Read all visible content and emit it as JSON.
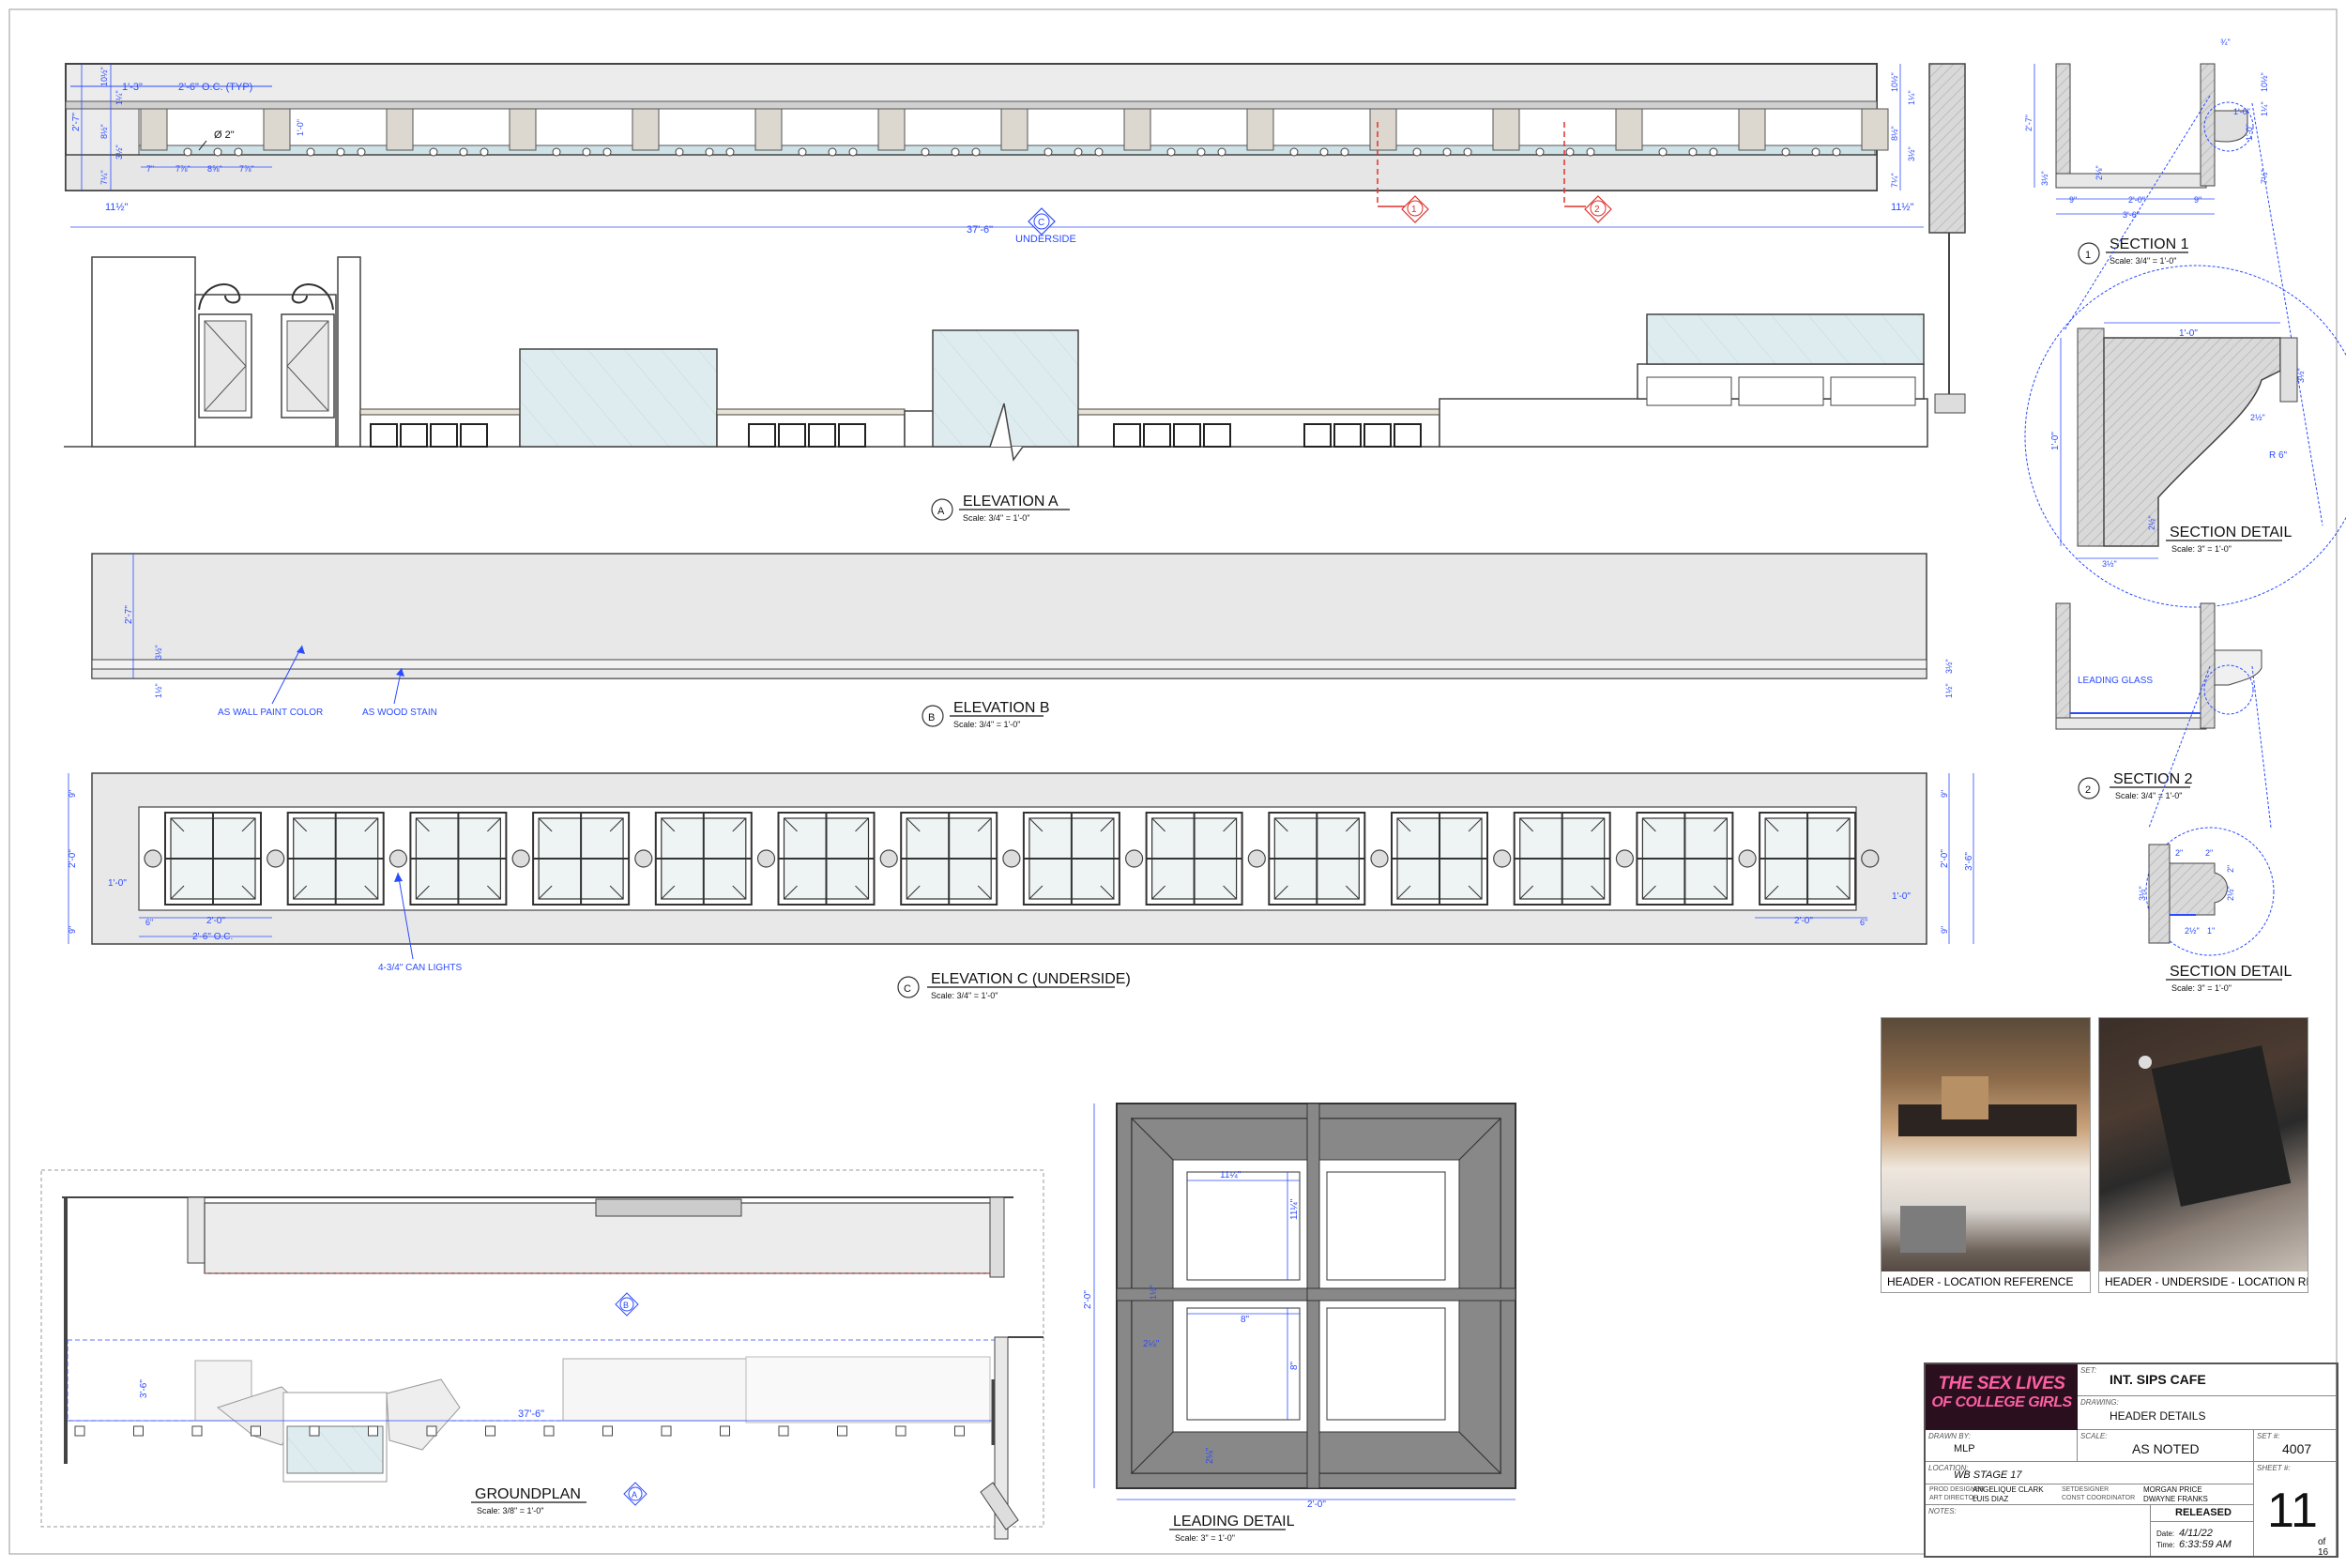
{
  "elevation_a": {
    "title": "ELEVATION A",
    "scale": "Scale: 3/4\" = 1'-0\"",
    "marker": "A",
    "dims": {
      "spacing": "2'-6\" O.C. (TYP)",
      "left_offset": "1'-3\"",
      "diameter": "Ø 2\"",
      "overall": "37'-6\"",
      "end_left": "11½\"",
      "end_right": "11½\"",
      "d1": "7\"",
      "d2": "7⅞\"",
      "d3": "8⅝\"",
      "d4": "7⅞\"",
      "h_total": "2'-7\"",
      "h_mid": "1'-0\"",
      "h_a": "10½\"",
      "h_b": "1¼\"",
      "h_c": "8½\"",
      "h_d": "3½\"",
      "h_e": "7¼\""
    },
    "underside_marker": "C",
    "underside_label": "UNDERSIDE",
    "section_tags": [
      "1",
      "2"
    ]
  },
  "elevation_b": {
    "title": "ELEVATION B",
    "scale": "Scale: 3/4\" = 1'-0\"",
    "marker": "B",
    "notes": [
      "AS WALL PAINT COLOR",
      "AS WOOD STAIN"
    ],
    "dims": {
      "h_total": "2'-7\"",
      "h_a": "3½\"",
      "h_b": "1½\"",
      "r_a": "3½\"",
      "r_b": "1½\""
    }
  },
  "elevation_c": {
    "title": "ELEVATION C (UNDERSIDE)",
    "scale": "Scale: 3/4\" = 1'-0\"",
    "marker": "C",
    "note": "4-3/4\" CAN LIGHTS",
    "dims": {
      "top": "9\"",
      "bottom": "9\"",
      "height": "2'-0\"",
      "height_r": "3'-6\"",
      "left": "1'-0\"",
      "right": "1'-0\"",
      "six": "6\"",
      "two": "2'-0\"",
      "oc": "2'-6\" O.C.",
      "two_r": "2'-0\"",
      "six_r": "6\"",
      "top_r": "9\"",
      "bottom_r": "9\"",
      "height_r2": "2'-0\""
    },
    "panel_count": 14
  },
  "groundplan": {
    "title": "GROUNDPLAN",
    "scale": "Scale: 3/8\" = 1'-0\"",
    "marker_b": "B",
    "marker_a": "A",
    "dims": {
      "overall": "37'-6\"",
      "depth": "3'-6\""
    }
  },
  "leading_detail": {
    "title": "LEADING DETAIL",
    "scale": "Scale: 3\" = 1'-0\"",
    "dims": {
      "a": "11¼\"",
      "b": "11¼\"",
      "c": "1½\"",
      "d": "8\"",
      "e": "8\"",
      "f": "2¼\"",
      "g": "2¼\"",
      "h": "2'-0\"",
      "w": "2'-0\""
    }
  },
  "section1": {
    "title": "SECTION 1",
    "scale": "Scale: 3/4\" = 1'-0\"",
    "number": "1",
    "dims": {
      "top": "¾\"",
      "h": "2'-7\"",
      "a": "10½\"",
      "b": "1¼\"",
      "c": "1'-0\"",
      "d": "3½\"",
      "e": "1½\"",
      "f": "9\"",
      "g": "2'-0\"",
      "h2": "9\"",
      "w": "3'-6\"",
      "i": "2⅛\"",
      "j": "1'-0\"",
      "k": "3½\"",
      "l": "7½\""
    }
  },
  "section_detail_1": {
    "title": "SECTION DETAIL",
    "scale": "Scale: 3\" = 1'-0\"",
    "dims": {
      "top": "1'-0\"",
      "a": "3½\"",
      "b": "2½\"",
      "r": "R 6\"",
      "h": "1'-0\"",
      "c": "2½\"",
      "bottom": "3½\""
    }
  },
  "section2": {
    "title": "SECTION 2",
    "scale": "Scale: 3/4\" = 1'-0\"",
    "number": "2",
    "note": "LEADING GLASS"
  },
  "section_detail_2": {
    "title": "SECTION DETAIL",
    "scale": "Scale: 3\" = 1'-0\"",
    "dims": {
      "a": "2\"",
      "b": "2\"",
      "c": "3½\"",
      "d": "2\"",
      "e": "2½\"",
      "f": "2½\"",
      "g": "1\""
    }
  },
  "photos": [
    {
      "caption": "HEADER - LOCATION REFERENCE"
    },
    {
      "caption": "HEADER - UNDERSIDE - LOCATION REFERENCE"
    }
  ],
  "title_block": {
    "logo_line1": "THE SEX LIVES",
    "logo_line2": "OF COLLEGE GIRLS",
    "set_label": "SET:",
    "set": "INT. SIPS CAFE",
    "drawing_label": "DRAWING:",
    "drawing": "HEADER DETAILS",
    "drawn_by_label": "DRAWN BY:",
    "drawn_by": "MLP",
    "scale_label": "SCALE:",
    "scale": "AS NOTED",
    "set_no_label": "SET #:",
    "set_no": "4007",
    "location_label": "LOCATION:",
    "location": "WB STAGE 17",
    "sheet_label": "SHEET #:",
    "sheet": "11",
    "sheet_of": "of 16",
    "prod_designer_label": "PROD DESIGNER",
    "prod_designer": "ANGELIQUE CLARK",
    "art_director_label": "ART DIRECTOR",
    "art_director": "LUIS DIAZ",
    "set_designer_label": "SETDESIGNER",
    "set_designer": "MORGAN PRICE",
    "const_coord_label": "CONST COORDINATOR",
    "const_coord": "DWAYNE FRANKS",
    "notes_label": "NOTES:",
    "status": "RELEASED",
    "date_label": "Date:",
    "date": "4/11/22",
    "time_label": "Time:",
    "time": "6:33:59 AM"
  },
  "colors": {
    "line": "#3a3a3a",
    "dim": "#2b4bff",
    "red": "#e0302a",
    "header_fill": "#e6e6e6",
    "block_fill": "#dcd8cf",
    "glass": "#dbe9ee",
    "logo_bg": "#2a0f1f",
    "logo_text": "#ff5fa2"
  }
}
